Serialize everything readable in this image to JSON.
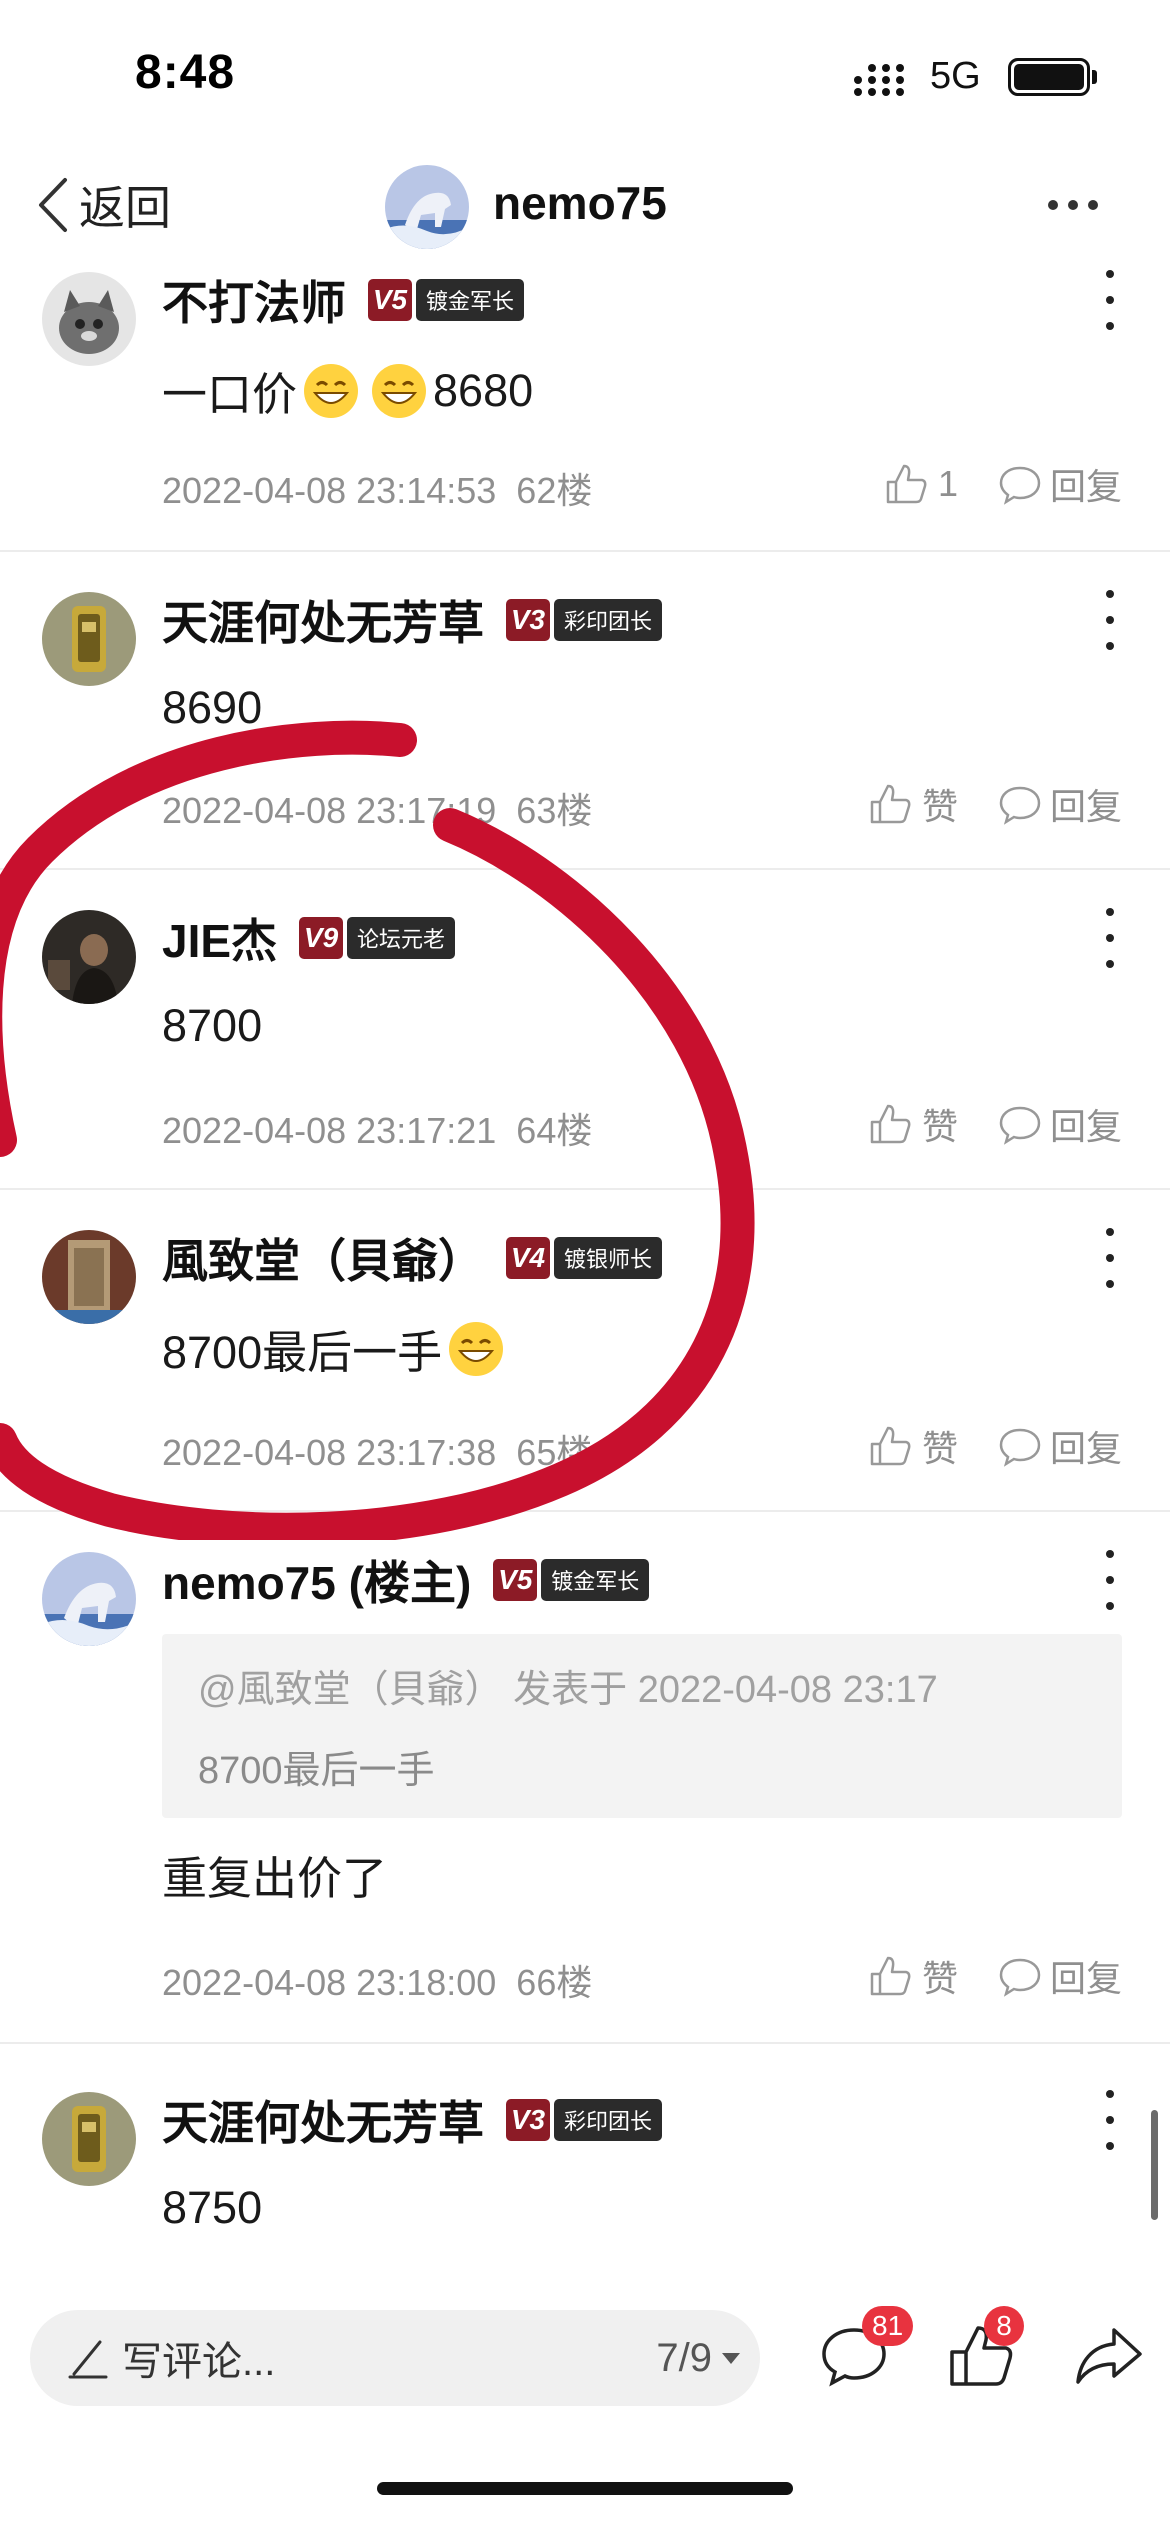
{
  "status_bar": {
    "time": "8:48",
    "network": "5G",
    "battery_level": 1.0
  },
  "nav": {
    "back_label": "返回",
    "title": "nemo75"
  },
  "posts": [
    {
      "username": "不打法师",
      "level": "V5",
      "title_badge": "镀金军长",
      "content_text": "一口价",
      "content_tail": "8680",
      "emoji_count": 2,
      "timestamp": "2022-04-08 23:14:53",
      "floor": "62楼",
      "like_label": "1",
      "reply_label": "回复"
    },
    {
      "username": "天涯何处无芳草",
      "level": "V3",
      "title_badge": "彩印团长",
      "content_text": "8690",
      "timestamp": "2022-04-08 23:17:19",
      "floor": "63楼",
      "like_label": "赞",
      "reply_label": "回复"
    },
    {
      "username": "JIE杰",
      "level": "V9",
      "title_badge": "论坛元老",
      "content_text": "8700",
      "timestamp": "2022-04-08 23:17:21",
      "floor": "64楼",
      "like_label": "赞",
      "reply_label": "回复"
    },
    {
      "username": "風致堂（貝爺）",
      "level": "V4",
      "title_badge": "镀银师长",
      "content_text": "8700最后一手",
      "emoji_count": 1,
      "timestamp": "2022-04-08 23:17:38",
      "floor": "65楼",
      "like_label": "赞",
      "reply_label": "回复"
    },
    {
      "username": "nemo75 (楼主)",
      "level": "V5",
      "title_badge": "镀金军长",
      "quote_header": "@風致堂（貝爺） 发表于 2022-04-08 23:17",
      "quote_text": "8700最后一手",
      "content_text": "重复出价了",
      "timestamp": "2022-04-08 23:18:00",
      "floor": "66楼",
      "like_label": "赞",
      "reply_label": "回复"
    },
    {
      "username": "天涯何处无芳草",
      "level": "V3",
      "title_badge": "彩印团长",
      "content_text": "8750"
    }
  ],
  "bottom_bar": {
    "comment_placeholder": "写评论...",
    "page_indicator": "7/9",
    "comment_count": "81",
    "like_count": "8"
  },
  "colors": {
    "accent_red": "#e8333f",
    "level_badge": "#8c1b26",
    "title_badge": "#2b2b2b",
    "annotation": "#c8102e"
  },
  "icons": [
    "back-chevron-icon",
    "more-icon",
    "kebab-icon",
    "thumbs-up-icon",
    "reply-bubble-icon",
    "pencil-icon",
    "comment-icon",
    "like-icon",
    "share-icon",
    "grin-emoji-icon"
  ]
}
